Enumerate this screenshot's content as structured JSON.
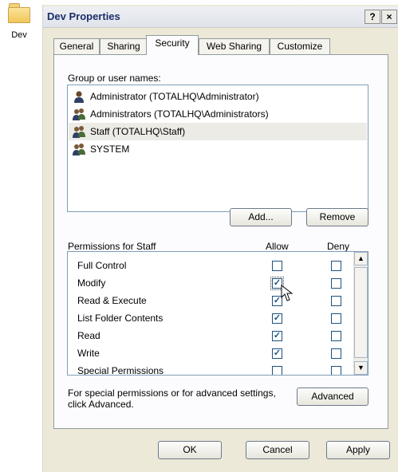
{
  "desktop": {
    "icon_label": "Dev"
  },
  "window": {
    "title": "Dev Properties",
    "help_button": "?",
    "close_button": "×"
  },
  "tabs": [
    {
      "label": "General",
      "active": false
    },
    {
      "label": "Sharing",
      "active": false
    },
    {
      "label": "Security",
      "active": true
    },
    {
      "label": "Web Sharing",
      "active": false
    },
    {
      "label": "Customize",
      "active": false
    }
  ],
  "group_label": "Group or user names:",
  "users": [
    {
      "name": "Administrator (TOTALHQ\\Administrator)",
      "icon": "user-icon",
      "selected": false
    },
    {
      "name": "Administrators (TOTALHQ\\Administrators)",
      "icon": "group-icon",
      "selected": false
    },
    {
      "name": "Staff (TOTALHQ\\Staff)",
      "icon": "group-icon",
      "selected": true
    },
    {
      "name": "SYSTEM",
      "icon": "group-icon",
      "selected": false
    }
  ],
  "buttons": {
    "add": "Add...",
    "remove": "Remove",
    "advanced": "Advanced",
    "ok": "OK",
    "cancel": "Cancel",
    "apply": "Apply"
  },
  "permissions": {
    "label": "Permissions for Staff",
    "allow_header": "Allow",
    "deny_header": "Deny",
    "rows": [
      {
        "name": "Full Control",
        "allow": false,
        "deny": false
      },
      {
        "name": "Modify",
        "allow": true,
        "deny": false
      },
      {
        "name": "Read & Execute",
        "allow": true,
        "deny": false
      },
      {
        "name": "List Folder Contents",
        "allow": true,
        "deny": false
      },
      {
        "name": "Read",
        "allow": true,
        "deny": false
      },
      {
        "name": "Write",
        "allow": true,
        "deny": false
      },
      {
        "name": "Special Permissions",
        "allow": false,
        "deny": false
      }
    ]
  },
  "advanced_note": "For special permissions or for advanced settings, click Advanced."
}
